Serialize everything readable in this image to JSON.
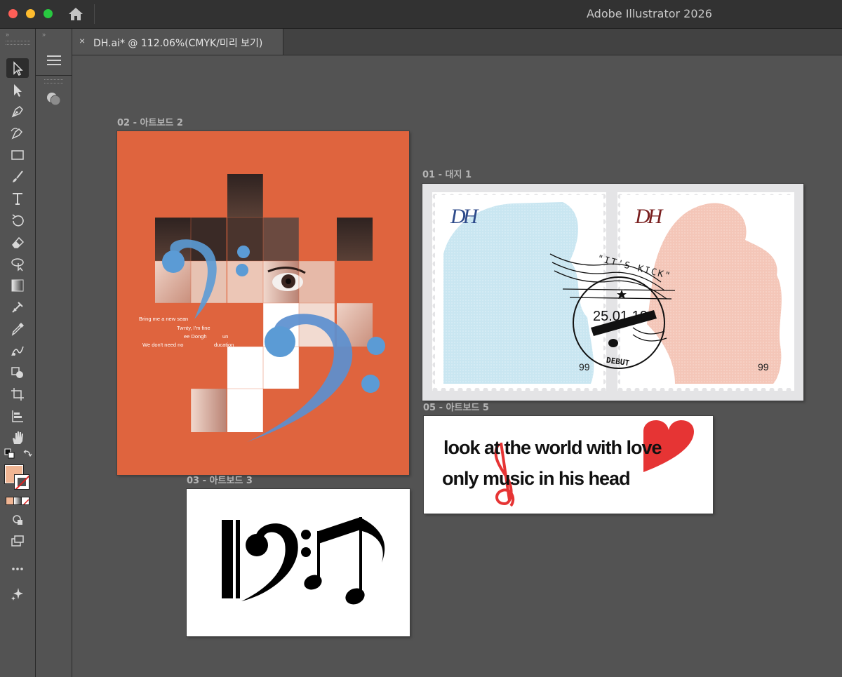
{
  "app_title": "Adobe Illustrator 2026",
  "document_tab": {
    "close": "×",
    "name": "DH.ai* @ 112.06%(CMYK/미리 보기)"
  },
  "collapse_glyph": "››",
  "artboards": {
    "ab2": {
      "label": "02 - 아트보드 2",
      "lines": [
        "Bring me a new sea",
        "n",
        "Tw",
        "nty, I'm fine",
        "ee Dongh",
        "un",
        "We don't need no",
        "ducation"
      ]
    },
    "ab1": {
      "label": "01 - 대지 1",
      "left_monogram": "DH",
      "right_monogram": "DH",
      "left_price": "99",
      "right_price": "99",
      "postmark_date": "25.01.10",
      "postmark_bottom": "DEBUT",
      "postmark_top": "\"IT'S KICK\""
    },
    "ab5": {
      "label": "05 - 아트보드 5",
      "line1": "look at the world with love",
      "line2": "only music in his head"
    },
    "ab3": {
      "label": "03 - 아트보드 3"
    }
  },
  "colors": {
    "orange": "#df643e",
    "blue": "#5b9bd5",
    "stamp_blue": "#c9e6f1",
    "stamp_pink": "#f4c6b8",
    "red_heart": "#e63434"
  }
}
